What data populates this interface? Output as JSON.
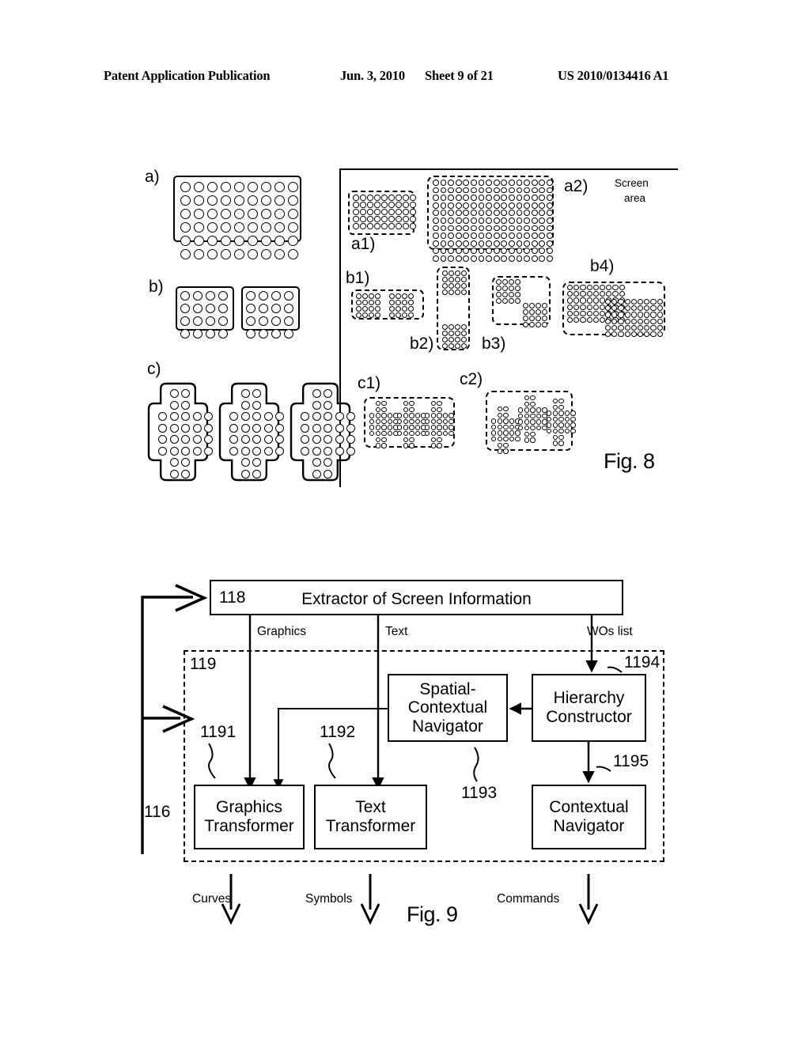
{
  "header": {
    "publication": "Patent Application Publication",
    "date": "Jun. 3, 2010",
    "sheet": "Sheet 9 of 21",
    "number": "US 2010/0134416 A1"
  },
  "figure8": {
    "caption": "Fig. 8",
    "left_labels": {
      "a": "a)",
      "b": "b)",
      "c": "c)"
    },
    "right_labels": {
      "a1": "a1)",
      "a2": "a2)",
      "b1": "b1)",
      "b2": "b2)",
      "b3": "b3)",
      "b4": "b4)",
      "c1": "c1)",
      "c2": "c2)"
    },
    "screen_area_label_line1": "Screen",
    "screen_area_label_line2": "area"
  },
  "figure9": {
    "caption": "Fig. 9",
    "boxes": {
      "extractor": {
        "number": "118",
        "label": "Extractor of Screen Information"
      },
      "graphics_transformer": {
        "number": "1191",
        "label": "Graphics\nTransformer",
        "line1": "Graphics",
        "line2": "Transformer"
      },
      "text_transformer": {
        "number": "1192",
        "label": "Text\nTransformer",
        "line1": "Text",
        "line2": "Transformer"
      },
      "spatial_contextual_navigator": {
        "number": "1193",
        "line1": "Spatial-",
        "line2": "Contextual",
        "line3": "Navigator"
      },
      "hierarchy_constructor": {
        "number": "1194",
        "line1": "Hierarchy",
        "line2": "Constructor"
      },
      "contextual_navigator": {
        "number": "1195",
        "line1": "Contextual",
        "line2": "Navigator"
      }
    },
    "group_number": "119",
    "feedback_number": "116",
    "flows": {
      "graphics": "Graphics",
      "text": "Text",
      "wos_list": "WOs list"
    },
    "outputs": {
      "curves": "Curves",
      "symbols": "Symbols",
      "commands": "Commands"
    }
  }
}
